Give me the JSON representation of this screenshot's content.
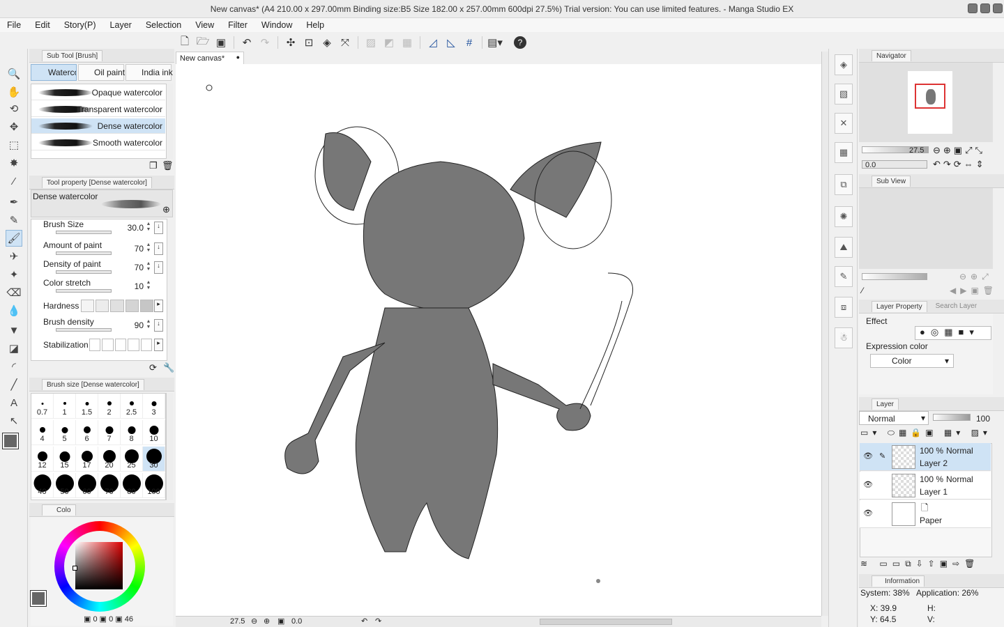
{
  "titlebar": {
    "text": "New canvas* (A4 210.00 x 297.00mm Binding size:B5 Size 182.00 x 257.00mm 600dpi 27.5%)  Trial version: You can use limited features. - Manga Studio EX"
  },
  "menu": [
    "File",
    "Edit",
    "Story(P)",
    "Layer",
    "Selection",
    "View",
    "Filter",
    "Window",
    "Help"
  ],
  "subtool": {
    "header": "Sub Tool [Brush]",
    "tabs": [
      "Waterco",
      "Oil paint",
      "India ink"
    ],
    "brushes": [
      "Opaque watercolor",
      "Transparent watercolor",
      "Dense watercolor",
      "Smooth watercolor"
    ],
    "selected": "Dense watercolor"
  },
  "toolprop": {
    "header": "Tool property [Dense watercolor]",
    "name": "Dense watercolor",
    "props": [
      {
        "label": "Brush Size",
        "value": "30.0",
        "level": 0.3
      },
      {
        "label": "Amount of paint",
        "value": "70",
        "level": 0.7
      },
      {
        "label": "Density of paint",
        "value": "70",
        "level": 0.7
      },
      {
        "label": "Color stretch",
        "value": "10",
        "level": 0.1
      },
      {
        "label": "Hardness",
        "value": ""
      },
      {
        "label": "Brush density",
        "value": "90",
        "level": 0.9
      },
      {
        "label": "Stabilization",
        "value": ""
      }
    ]
  },
  "brushsize": {
    "header": "Brush size [Dense watercolor]",
    "sizes": [
      "0.7",
      "1",
      "1.5",
      "2",
      "2.5",
      "3",
      "4",
      "5",
      "6",
      "7",
      "8",
      "10",
      "12",
      "15",
      "17",
      "20",
      "25",
      "30",
      "40",
      "50",
      "60",
      "70",
      "80",
      "100"
    ],
    "selected": "30"
  },
  "color": {
    "tab": "Colo",
    "hsv_h": "0",
    "hsv_s": "0",
    "hsv_v": "46",
    "current": "#666666"
  },
  "canvas": {
    "tab": "New canvas*",
    "zoom": "27.5",
    "rotation": "0.0"
  },
  "navigator": {
    "header": "Navigator",
    "zoom": "27.5",
    "rotation": "0.0"
  },
  "subview": {
    "header": "Sub View"
  },
  "layerprop": {
    "header": "Layer Property",
    "search": "Search Layer",
    "effect": "Effect",
    "expression_color": "Expression color",
    "expression_value": "Color"
  },
  "layers": {
    "header": "Layer",
    "blend": "Normal",
    "opacity": "100",
    "items": [
      {
        "opacity": "100 %",
        "mode": "Normal",
        "name": "Layer 2",
        "selected": true
      },
      {
        "opacity": "100 %",
        "mode": "Normal",
        "name": "Layer 1",
        "selected": false
      },
      {
        "opacity": "",
        "mode": "",
        "name": "Paper",
        "selected": false
      }
    ]
  },
  "info": {
    "header": "Information",
    "system": "System: 38%",
    "application": "Application: 26%",
    "x": "X: 39.9",
    "y": "Y: 64.5",
    "h": "H:",
    "v": "V:"
  }
}
